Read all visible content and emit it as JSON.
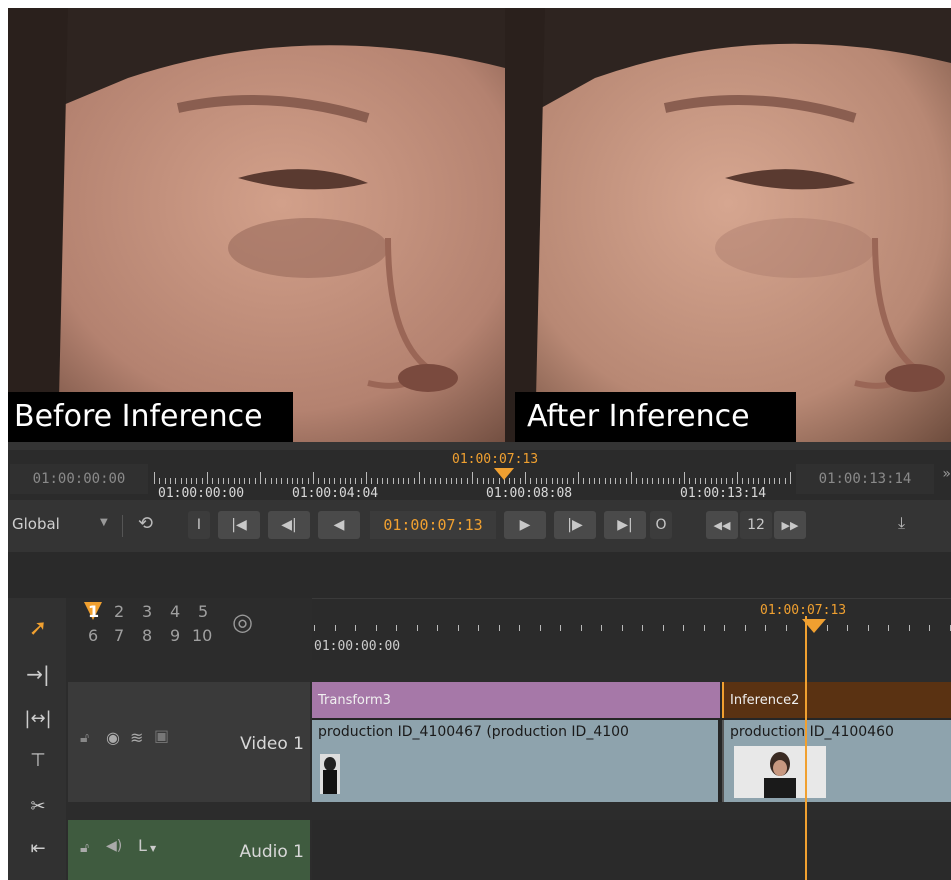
{
  "viewer": {
    "before_label": "Before Inference",
    "after_label": "After Inference"
  },
  "scrubber": {
    "in_timecode": "01:00:00:00",
    "out_timecode": "01:00:13:14",
    "playhead_timecode": "01:00:07:13",
    "ruler_labels": [
      "01:00:00:00",
      "01:00:04:04",
      "01:00:08:08",
      "01:00:13:14"
    ]
  },
  "controls": {
    "mode": "Global",
    "in_button": "I",
    "out_button": "O",
    "current_timecode": "01:00:07:13",
    "step_value": "12"
  },
  "presets": {
    "row1": [
      "1",
      "2",
      "3",
      "4",
      "5"
    ],
    "row2": [
      "6",
      "7",
      "8",
      "9",
      "10"
    ]
  },
  "timeline": {
    "start_timecode": "01:00:00:00",
    "playhead_timecode": "01:00:07:13"
  },
  "tracks": {
    "video": {
      "name": "Video 1",
      "effects": [
        "Transform3",
        "Inference2"
      ],
      "clips": [
        "production ID_4100467 (production ID_4100",
        "production ID_4100460"
      ]
    },
    "audio": {
      "name": "Audio 1",
      "channel": "L"
    }
  },
  "colors": {
    "accent": "#f0a030",
    "transform_effect": "#a678a8",
    "inference_effect": "#5a3212",
    "clip": "#8ea3ad",
    "audio_header": "#3f5b3f"
  }
}
